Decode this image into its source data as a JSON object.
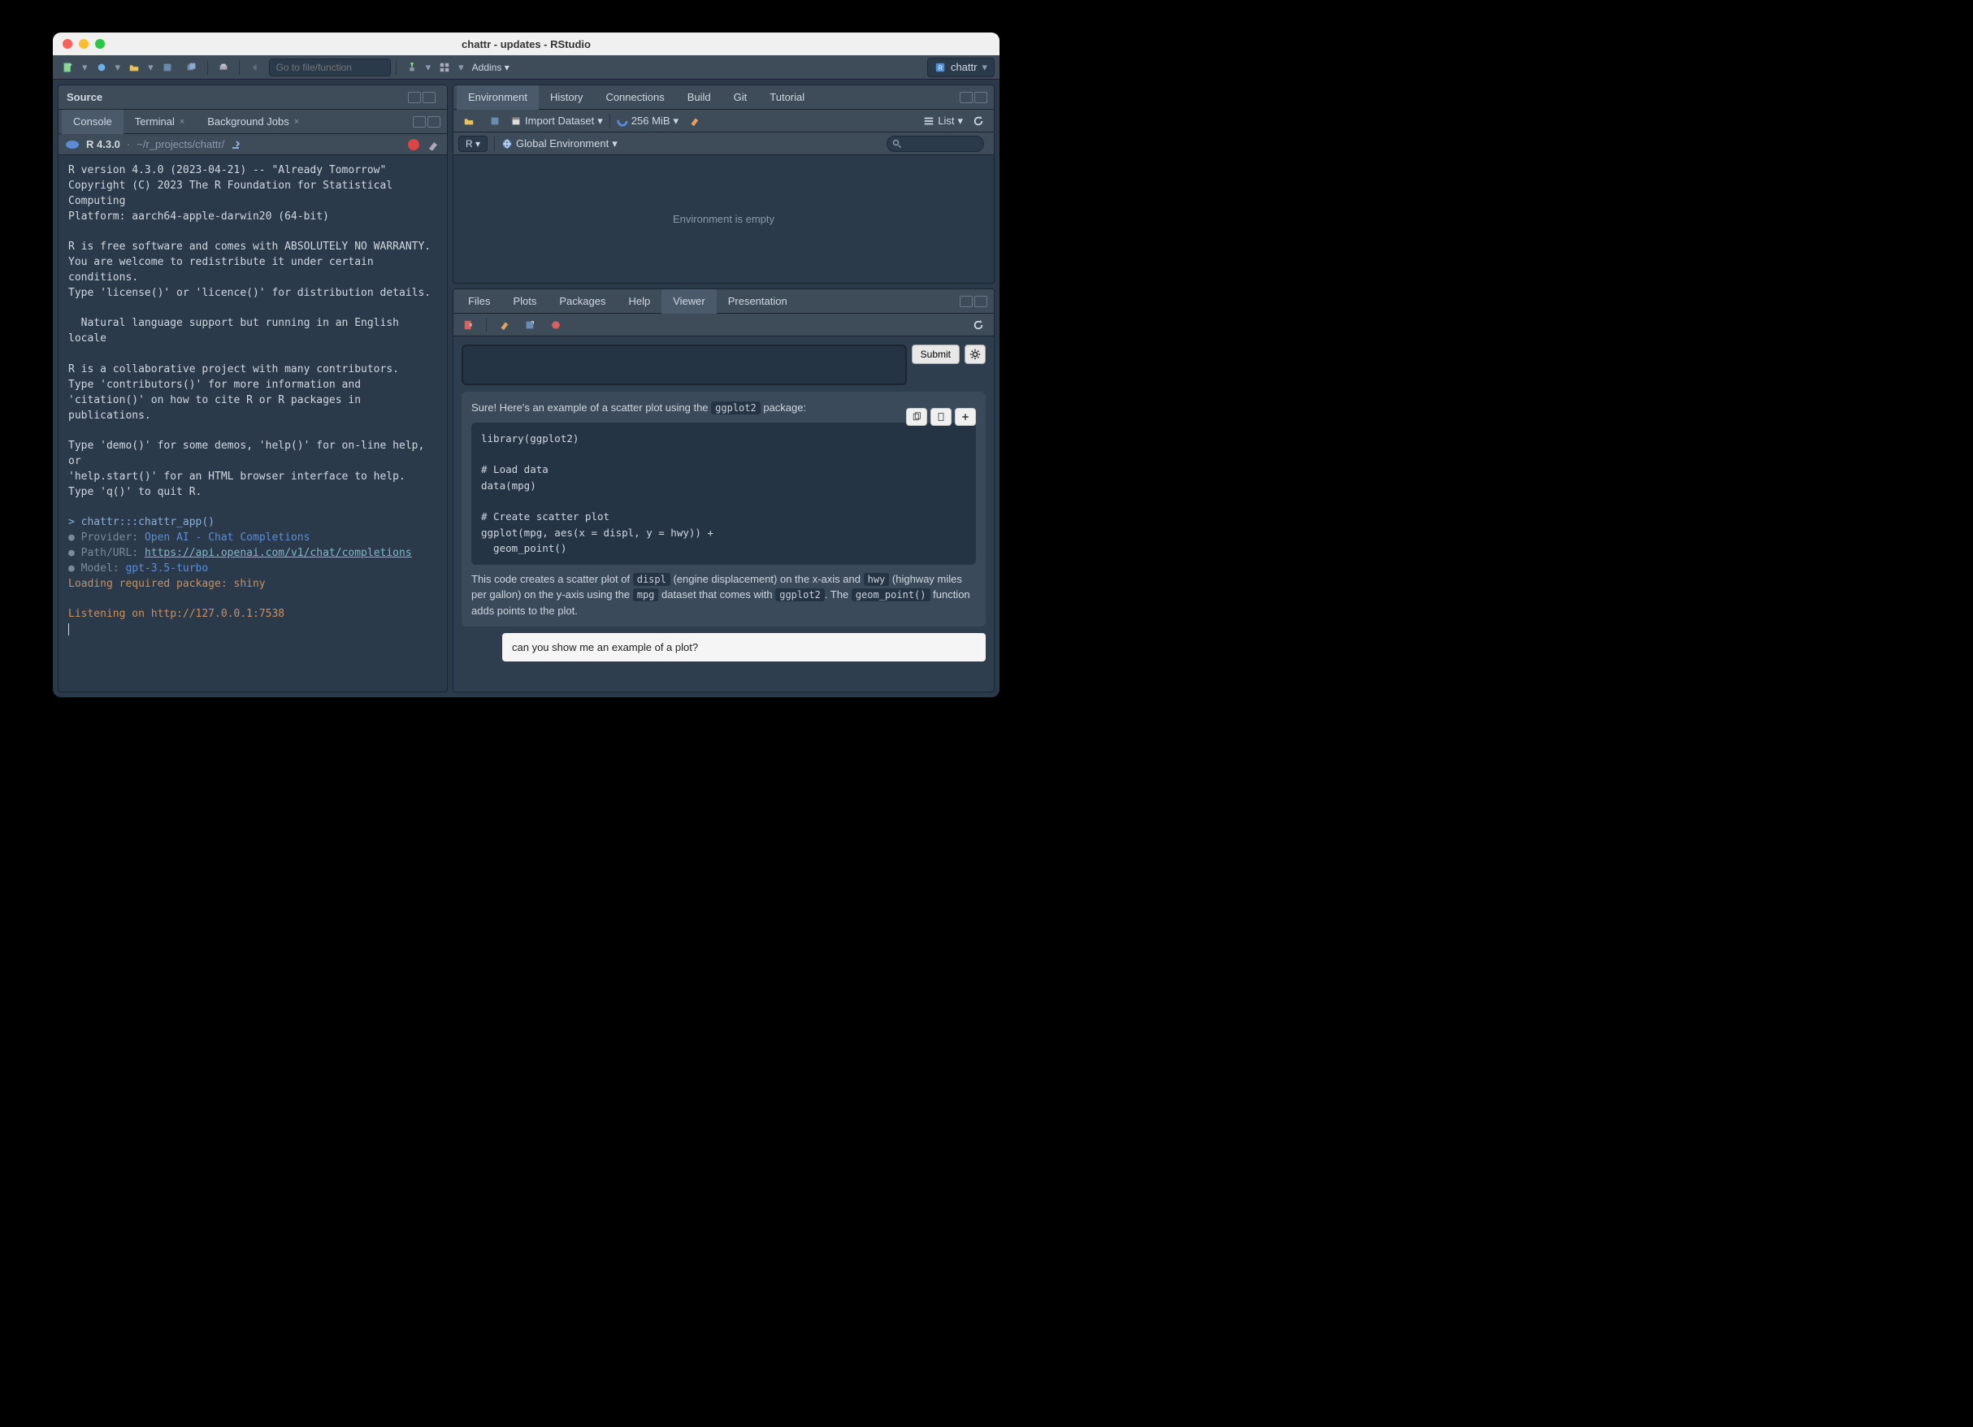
{
  "window": {
    "title": "chattr - updates - RStudio"
  },
  "toolbar": {
    "goto_placeholder": "Go to file/function",
    "addins_label": "Addins",
    "project_name": "chattr"
  },
  "source": {
    "title": "Source"
  },
  "left_tabs": {
    "console": "Console",
    "terminal": "Terminal",
    "background_jobs": "Background Jobs"
  },
  "console": {
    "version": "R 4.3.0",
    "path": "~/r_projects/chattr/",
    "body": {
      "t1": "R version 4.3.0 (2023-04-21) -- \"Already Tomorrow\"\nCopyright (C) 2023 The R Foundation for Statistical Computing\nPlatform: aarch64-apple-darwin20 (64-bit)\n\nR is free software and comes with ABSOLUTELY NO WARRANTY.\nYou are welcome to redistribute it under certain conditions.\nType 'license()' or 'licence()' for distribution details.\n\n  Natural language support but running in an English locale\n\nR is a collaborative project with many contributors.\nType 'contributors()' for more information and\n'citation()' on how to cite R or R packages in publications.\n\nType 'demo()' for some demos, 'help()' for on-line help, or\n'help.start()' for an HTML browser interface to help.\nType 'q()' to quit R.",
      "cmd1": "> chattr:::chattr_app()",
      "provider_k": "Provider:",
      "provider_v": "Open AI - Chat Completions",
      "path_k": "Path/URL:",
      "path_v": "https://api.openai.com/v1/chat/completions",
      "model_k": "Model:",
      "model_v": "gpt-3.5-turbo",
      "loading": "Loading required package: shiny",
      "listening": "Listening on http://127.0.0.1:7538"
    }
  },
  "env_tabs": {
    "environment": "Environment",
    "history": "History",
    "connections": "Connections",
    "build": "Build",
    "git": "Git",
    "tutorial": "Tutorial"
  },
  "env": {
    "import_label": "Import Dataset",
    "memory": "256 MiB",
    "list_label": "List",
    "r_label": "R",
    "scope": "Global Environment",
    "empty": "Environment is empty"
  },
  "viewer_tabs": {
    "files": "Files",
    "plots": "Plots",
    "packages": "Packages",
    "help": "Help",
    "viewer": "Viewer",
    "presentation": "Presentation"
  },
  "viewer": {
    "submit": "Submit",
    "assistant_pre": "Sure! Here's an example of a scatter plot using the ",
    "assistant_pkg": "ggplot2",
    "assistant_post": " package:",
    "code": "library(ggplot2)\n\n# Load data\ndata(mpg)\n\n# Create scatter plot\nggplot(mpg, aes(x = displ, y = hwy)) +\n  geom_point()",
    "exp_1": "This code creates a scatter plot of ",
    "exp_displ": "displ",
    "exp_2": " (engine displacement) on the x-axis and ",
    "exp_hwy": "hwy",
    "exp_3": " (highway miles per gallon) on the y-axis using the ",
    "exp_mpg": "mpg",
    "exp_4": " dataset that comes with ",
    "exp_ggplot2": "ggplot2",
    "exp_5": ". The ",
    "exp_geom": "geom_point()",
    "exp_6": " function adds points to the plot.",
    "user_msg": "can you show me an example of a plot?"
  }
}
